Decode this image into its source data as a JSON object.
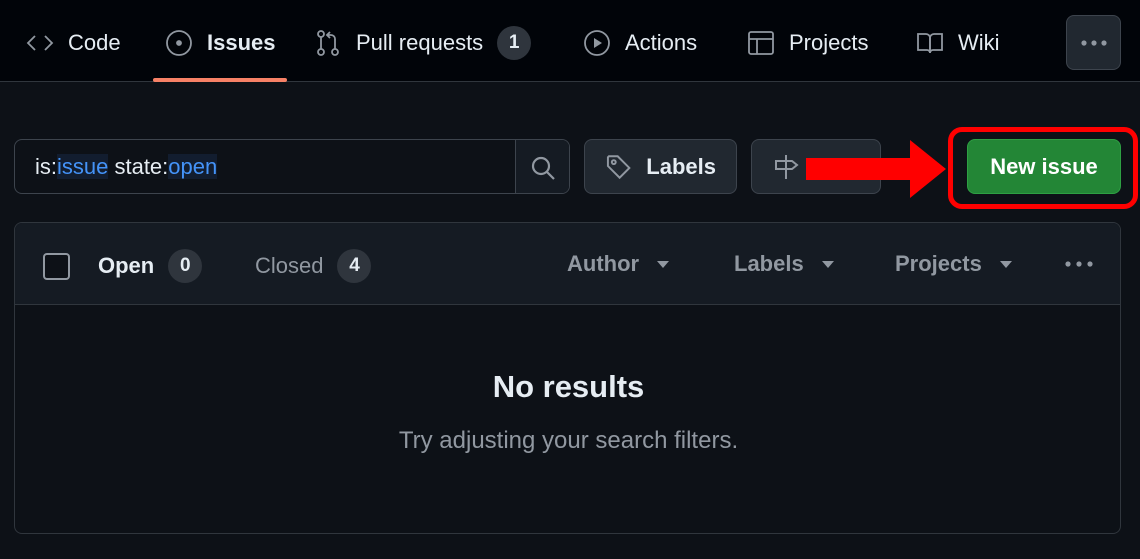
{
  "nav": {
    "tabs": [
      {
        "label": "Code",
        "icon": "code-icon"
      },
      {
        "label": "Issues",
        "icon": "issue-opened-icon",
        "selected": true
      },
      {
        "label": "Pull requests",
        "icon": "git-pull-request-icon",
        "counter": "1"
      },
      {
        "label": "Actions",
        "icon": "play-icon"
      },
      {
        "label": "Projects",
        "icon": "table-icon"
      },
      {
        "label": "Wiki",
        "icon": "book-icon"
      }
    ],
    "more_icon": "kebab-horizontal-icon"
  },
  "toolbar": {
    "search": {
      "parts": [
        "is:",
        "issue",
        " state:",
        "open"
      ],
      "icon": "search-icon"
    },
    "labels_button": "Labels",
    "milestones_icon": "milestone-icon",
    "new_issue_button": "New issue",
    "annotation": {
      "arrow_color": "#ff0000",
      "box_color": "#ff0000"
    }
  },
  "list": {
    "open_label": "Open",
    "open_count": "0",
    "closed_label": "Closed",
    "closed_count": "4",
    "filters": [
      "Author",
      "Labels",
      "Projects"
    ],
    "more_icon": "kebab-horizontal-icon",
    "empty_title": "No results",
    "empty_subtitle": "Try adjusting your search filters."
  },
  "colors": {
    "accent_green": "#238636",
    "selected_underline": "#f78166",
    "link_blue": "#4493f8",
    "background": "#0d1117"
  }
}
